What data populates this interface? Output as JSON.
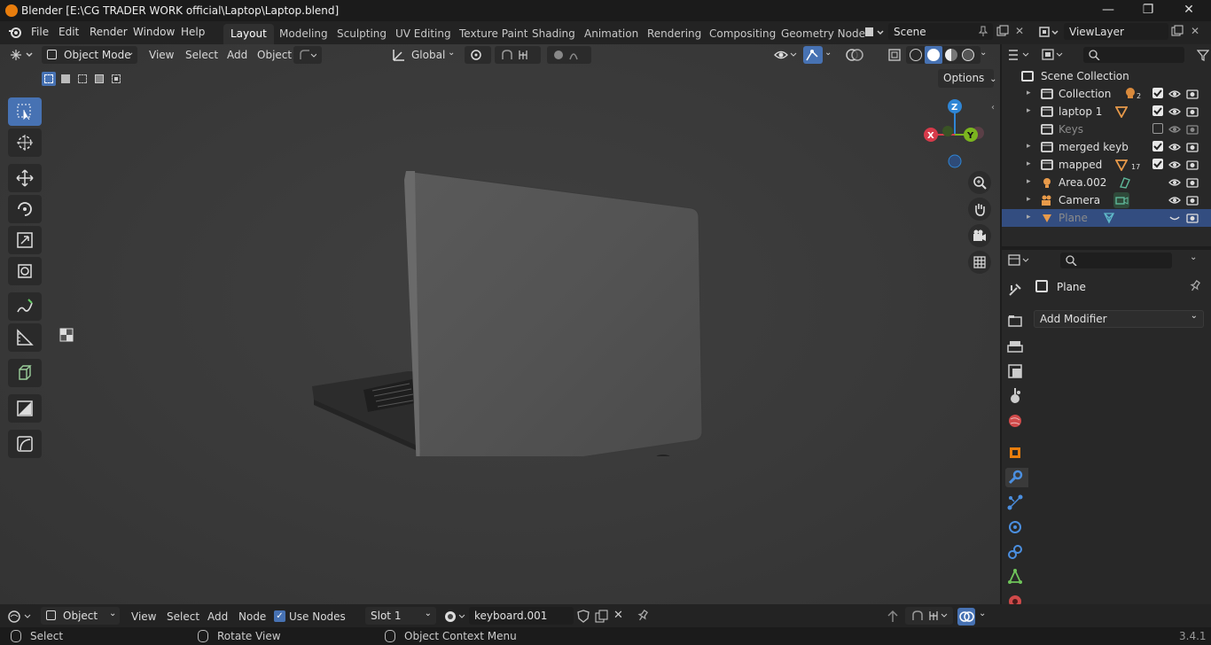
{
  "window": {
    "title": "Blender [E:\\CG TRADER WORK official\\Laptop\\Laptop.blend]",
    "controls": [
      "—",
      "❐",
      "✕"
    ]
  },
  "menu": [
    "File",
    "Edit",
    "Render",
    "Window",
    "Help"
  ],
  "workspaces": [
    "Layout",
    "Modeling",
    "Sculpting",
    "UV Editing",
    "Texture Paint",
    "Shading",
    "Animation",
    "Rendering",
    "Compositing",
    "Geometry Node"
  ],
  "scene": {
    "name": "Scene",
    "view_layer": "ViewLayer"
  },
  "viewport_header": {
    "mode": "Object Mode",
    "menus": [
      "View",
      "Select",
      "Add",
      "Object"
    ],
    "transform_orientation": "Global",
    "options_label": "Options"
  },
  "gizmo": {
    "z": "Z",
    "y": "Y",
    "x": "X"
  },
  "outliner": {
    "root": "Scene Collection",
    "items": [
      {
        "name": "Collection",
        "badge": "2",
        "icon": "collection-icon",
        "checked": true,
        "dim": false,
        "selected": false
      },
      {
        "name": "laptop 1",
        "badge": "",
        "icon": "collection-icon",
        "checked": true,
        "dim": false,
        "selected": false
      },
      {
        "name": "Keys",
        "badge": "",
        "icon": "collection-icon",
        "checked": false,
        "dim": true,
        "selected": false
      },
      {
        "name": "merged keyb",
        "badge": "",
        "icon": "collection-icon",
        "checked": true,
        "dim": false,
        "selected": false
      },
      {
        "name": "mapped",
        "badge": "17",
        "icon": "collection-icon",
        "checked": true,
        "dim": false,
        "selected": false
      },
      {
        "name": "Area.002",
        "badge": "",
        "icon": "light-icon",
        "checked": null,
        "dim": false,
        "selected": false
      },
      {
        "name": "Camera",
        "badge": "",
        "icon": "camera-icon",
        "checked": null,
        "dim": false,
        "selected": false
      },
      {
        "name": "Plane",
        "badge": "",
        "icon": "mesh-icon",
        "checked": null,
        "dim": true,
        "selected": true
      }
    ]
  },
  "properties": {
    "object_name": "Plane",
    "add_modifier": "Add Modifier"
  },
  "shader_header": {
    "editor_mode": "Object",
    "menus": [
      "View",
      "Select",
      "Add",
      "Node"
    ],
    "use_nodes_label": "Use Nodes",
    "use_nodes": true,
    "slot": "Slot 1",
    "material": "keyboard.001"
  },
  "statusbar": {
    "select": "Select",
    "rotate": "Rotate View",
    "context": "Object Context Menu",
    "version": "3.4.1"
  },
  "colors": {
    "accent": "#4772b3",
    "selected_row": "#334d80",
    "gizmo_x": "#d63a4a",
    "gizmo_y": "#7bb51f",
    "gizmo_z": "#2f86d6",
    "orange": "#e87d0d"
  }
}
